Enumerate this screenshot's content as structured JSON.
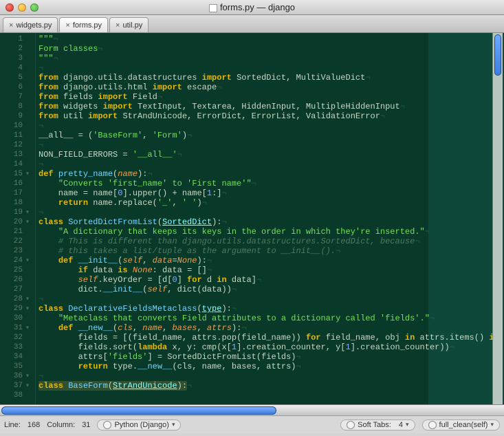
{
  "window": {
    "title": "forms.py — django"
  },
  "tabs": [
    {
      "label": "widgets.py",
      "active": false
    },
    {
      "label": "forms.py",
      "active": true
    },
    {
      "label": "util.py",
      "active": false
    }
  ],
  "gutter": {
    "start": 1,
    "end": 38
  },
  "fold_rows": [
    15,
    19,
    20,
    24,
    28,
    29,
    31,
    36,
    37
  ],
  "code_lines": [
    "<span class='st'>\"\"\"</span><span class='eol'>¬</span>",
    "<span class='st'>Form classes</span><span class='eol'>¬</span>",
    "<span class='st'>\"\"\"</span><span class='eol'>¬</span>",
    "<span class='eol'>¬</span>",
    "<span class='kw'>from</span> django.utils.datastructures <span class='kw'>import</span> SortedDict, MultiValueDict<span class='eol'>¬</span>",
    "<span class='kw'>from</span> django.utils.html <span class='kw'>import</span> escape<span class='eol'>¬</span>",
    "<span class='kw'>from</span> fields <span class='kw'>import</span> Field<span class='eol'>¬</span>",
    "<span class='kw'>from</span> widgets <span class='kw'>import</span> TextInput, Textarea, HiddenInput, MultipleHiddenInput<span class='eol'>¬</span>",
    "<span class='kw'>from</span> util <span class='kw'>import</span> StrAndUnicode, ErrorDict, ErrorList, ValidationError<span class='eol'>¬</span>",
    "<span class='eol'>¬</span>",
    "__all__ <span class='op'>=</span> (<span class='st'>'BaseForm'</span>, <span class='st'>'Form'</span>)<span class='eol'>¬</span>",
    "<span class='eol'>¬</span>",
    "NON_FIELD_ERRORS <span class='op'>=</span> <span class='st'>'__all__'</span><span class='eol'>¬</span>",
    "<span class='eol'>¬</span>",
    "<span class='kw'>def</span> <span class='fn'>pretty_name</span>(<span class='nm'>name</span>):<span class='eol'>¬</span>",
    "    <span class='st'>\"Converts 'first_name' to 'First name'\"</span><span class='eol'>¬</span>",
    "    name <span class='op'>=</span> name[<span class='num'>0</span>].upper() <span class='op'>+</span> name[<span class='num'>1</span>:]<span class='eol'>¬</span>",
    "    <span class='kw'>return</span> name.replace(<span class='st'>'_'</span>, <span class='st'>' '</span>)<span class='eol'>¬</span>",
    "<span class='eol'>¬</span>",
    "<span class='kw'>class</span> <span class='fn'>SortedDictFromList</span>(<span class='cl'>SortedDict</span>):<span class='eol'>¬</span>",
    "    <span class='st'>\"A dictionary that keeps its keys in the order in which they're inserted.\"</span><span class='eol'>¬</span>",
    "    <span class='co'># This is different than django.utils.datastructures.SortedDict, because</span><span class='eol'>¬</span>",
    "    <span class='co'># this takes a list/tuple as the argument to __init__().</span><span class='eol'>¬</span>",
    "    <span class='kw'>def</span> <span class='fn'>__init__</span>(<span class='sf'>self</span>, <span class='nm'>data</span><span class='op'>=</span><span class='nm'>None</span>):<span class='eol'>¬</span>",
    "        <span class='kw'>if</span> data <span class='kw'>is</span> <span class='nm'>None</span>: data <span class='op'>=</span> []<span class='eol'>¬</span>",
    "        <span class='sf'>self</span>.keyOrder <span class='op'>=</span> [d[<span class='num'>0</span>] <span class='kw'>for</span> d <span class='kw'>in</span> data]<span class='eol'>¬</span>",
    "        dict.<span class='fn'>__init__</span>(<span class='sf'>self</span>, dict(data))<span class='eol'>¬</span>",
    "<span class='eol'>¬</span>",
    "<span class='kw'>class</span> <span class='fn'>DeclarativeFieldsMetaclass</span>(<span class='cl'>type</span>):<span class='eol'>¬</span>",
    "    <span class='st'>\"Metaclass that converts Field attributes to a dictionary called 'fields'.\"</span><span class='eol'>¬</span>",
    "    <span class='kw'>def</span> <span class='fn'>__new__</span>(<span class='nm'>cls</span>, <span class='nm'>name</span>, <span class='nm'>bases</span>, <span class='nm'>attrs</span>):<span class='eol'>¬</span>",
    "        fields <span class='op'>=</span> [(field_name, attrs.pop(field_name)) <span class='kw'>for</span> field_name, obj <span class='kw'>in</span> attrs.items() <span class='kw'>i</span>",
    "        fields.sort(<span class='kw'>lambda</span> x, y: cmp(x[<span class='num'>1</span>].creation_counter, y[<span class='num'>1</span>].creation_counter))<span class='eol'>¬</span>",
    "        attrs[<span class='st'>'fields'</span>] <span class='op'>=</span> SortedDictFromList(fields)<span class='eol'>¬</span>",
    "        <span class='kw'>return</span> type.<span class='fn'>__new__</span>(cls, name, bases, attrs)<span class='eol'>¬</span>",
    "<span class='eol'>¬</span>",
    "<span class='mark'><span class='kw'>class</span> <span class='fn'>BaseForm</span>(<span class='cl'>StrAndUnicode</span>):</span><span class='eol'>¬</span>",
    ""
  ],
  "status": {
    "line_label": "Line:",
    "line": "168",
    "col_label": "Column:",
    "col": "31",
    "language": "Python (Django)",
    "softtabs_label": "Soft Tabs:",
    "softtabs": "4",
    "symbol": "full_clean(self)"
  }
}
